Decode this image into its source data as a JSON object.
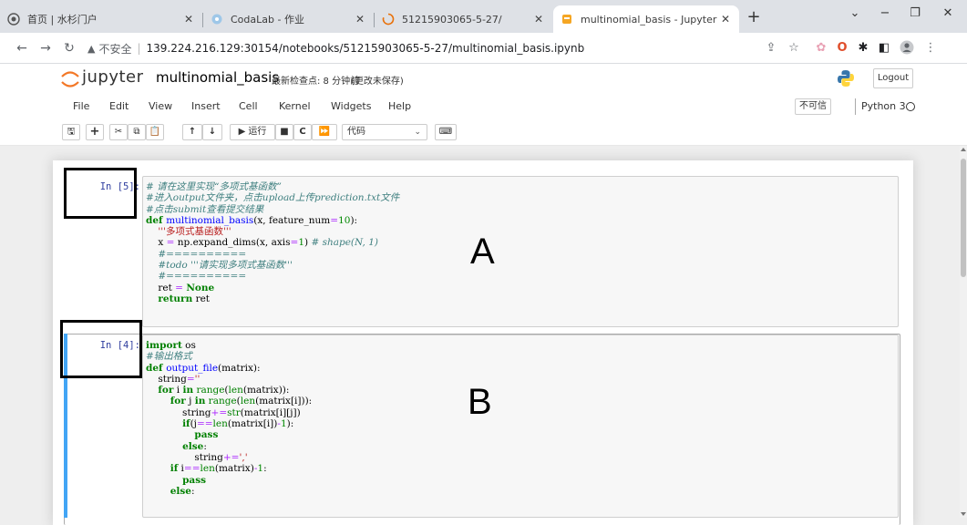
{
  "browser": {
    "tabs": [
      {
        "icon": "shanshan-portal-icon",
        "title": "首页 | 水杉门户"
      },
      {
        "icon": "codalab-icon",
        "title": "CodaLab - 作业"
      },
      {
        "icon": "loading-icon",
        "title": "51215903065-5-27/"
      },
      {
        "icon": "jupyter-tab-icon",
        "title": "multinomial_basis - Jupyter No",
        "active": true
      }
    ],
    "url_security": "不安全",
    "url": "139.224.216.129:30154/notebooks/51215903065-5-27/multinomial_basis.ipynb"
  },
  "jupyter": {
    "brand": "jupyter",
    "notebook_name": "multinomial_basis",
    "checkpoint": "最新检查点: 8 分钟前",
    "autosave": "(更改未保存)",
    "logout_label": "Logout",
    "menus": [
      "File",
      "Edit",
      "View",
      "Insert",
      "Cell",
      "Kernel",
      "Widgets",
      "Help"
    ],
    "trusted_label": "不可信",
    "kernel_name": "Python 3",
    "toolbar": {
      "run_label": "▶ 运行",
      "cell_type": "代码"
    }
  },
  "cells": [
    {
      "prompt": "In  [5]:",
      "lines": [
        [
          [
            "c",
            "# 请在这里实现“多项式基函数”"
          ]
        ],
        [
          [
            "c",
            "#进入output文件夹，点击upload上传prediction.txt文件"
          ]
        ],
        [
          [
            "c",
            "#点击submit查看提交结果"
          ]
        ],
        [
          [
            "k",
            "def "
          ],
          [
            "d",
            "multinomial_basis"
          ],
          [
            "t",
            "(x, feature_num"
          ],
          [
            "o",
            "="
          ],
          [
            "n",
            "10"
          ],
          [
            "t",
            "):"
          ]
        ],
        [
          [
            "t",
            "    "
          ],
          [
            "s",
            "'''多项式基函数'''"
          ]
        ],
        [
          [
            "t",
            "    x "
          ],
          [
            "o",
            "="
          ],
          [
            "t",
            " np.expand_dims(x, axis"
          ],
          [
            "o",
            "="
          ],
          [
            "n",
            "1"
          ],
          [
            "t",
            ") "
          ],
          [
            "c",
            "# shape(N, 1)"
          ]
        ],
        [
          [
            "t",
            "    "
          ],
          [
            "c",
            "#=========="
          ]
        ],
        [
          [
            "t",
            "    "
          ],
          [
            "c",
            "#todo '''请实现多项式基函数'''"
          ]
        ],
        [
          [
            "t",
            "    "
          ],
          [
            "c",
            "#=========="
          ]
        ],
        [
          [
            "t",
            "    ret "
          ],
          [
            "o",
            "="
          ],
          [
            "t",
            " "
          ],
          [
            "k",
            "None"
          ]
        ],
        [
          [
            "t",
            "    "
          ],
          [
            "k",
            "return"
          ],
          [
            "t",
            " ret"
          ]
        ]
      ]
    },
    {
      "prompt": "In  [4]:",
      "lines": [
        [
          [
            "k",
            "import"
          ],
          [
            "t",
            " os"
          ]
        ],
        [
          [
            "c",
            "#输出格式"
          ]
        ],
        [
          [
            "k",
            "def "
          ],
          [
            "d",
            "output_file"
          ],
          [
            "t",
            "(matrix):"
          ]
        ],
        [
          [
            "t",
            "    string"
          ],
          [
            "o",
            "="
          ],
          [
            "s",
            "''"
          ]
        ],
        [
          [
            "t",
            "    "
          ],
          [
            "k",
            "for"
          ],
          [
            "t",
            " i "
          ],
          [
            "k",
            "in"
          ],
          [
            "t",
            " "
          ],
          [
            "b",
            "range"
          ],
          [
            "t",
            "("
          ],
          [
            "b",
            "len"
          ],
          [
            "t",
            "(matrix)):"
          ]
        ],
        [
          [
            "t",
            "        "
          ],
          [
            "k",
            "for"
          ],
          [
            "t",
            " j "
          ],
          [
            "k",
            "in"
          ],
          [
            "t",
            " "
          ],
          [
            "b",
            "range"
          ],
          [
            "t",
            "("
          ],
          [
            "b",
            "len"
          ],
          [
            "t",
            "(matrix[i])):"
          ]
        ],
        [
          [
            "t",
            "            string"
          ],
          [
            "o",
            "+="
          ],
          [
            "b",
            "str"
          ],
          [
            "t",
            "(matrix[i][j])"
          ]
        ],
        [
          [
            "t",
            "            "
          ],
          [
            "k",
            "if"
          ],
          [
            "t",
            "(j"
          ],
          [
            "o",
            "=="
          ],
          [
            "b",
            "len"
          ],
          [
            "t",
            "(matrix[i])"
          ],
          [
            "o",
            "-"
          ],
          [
            "n",
            "1"
          ],
          [
            "t",
            "):"
          ]
        ],
        [
          [
            "t",
            "                "
          ],
          [
            "k",
            "pass"
          ]
        ],
        [
          [
            "t",
            "            "
          ],
          [
            "k",
            "else"
          ],
          [
            "t",
            ":"
          ]
        ],
        [
          [
            "t",
            "                string"
          ],
          [
            "o",
            "+="
          ],
          [
            "s",
            "','"
          ]
        ],
        [
          [
            "t",
            "        "
          ],
          [
            "k",
            "if"
          ],
          [
            "t",
            " i"
          ],
          [
            "o",
            "=="
          ],
          [
            "b",
            "len"
          ],
          [
            "t",
            "(matrix)"
          ],
          [
            "o",
            "-"
          ],
          [
            "n",
            "1"
          ],
          [
            "t",
            ":"
          ]
        ],
        [
          [
            "t",
            "            "
          ],
          [
            "k",
            "pass"
          ]
        ],
        [
          [
            "t",
            "        "
          ],
          [
            "k",
            "else"
          ],
          [
            "t",
            ":"
          ]
        ]
      ]
    }
  ],
  "annotations": {
    "a": "A",
    "b": "B"
  }
}
